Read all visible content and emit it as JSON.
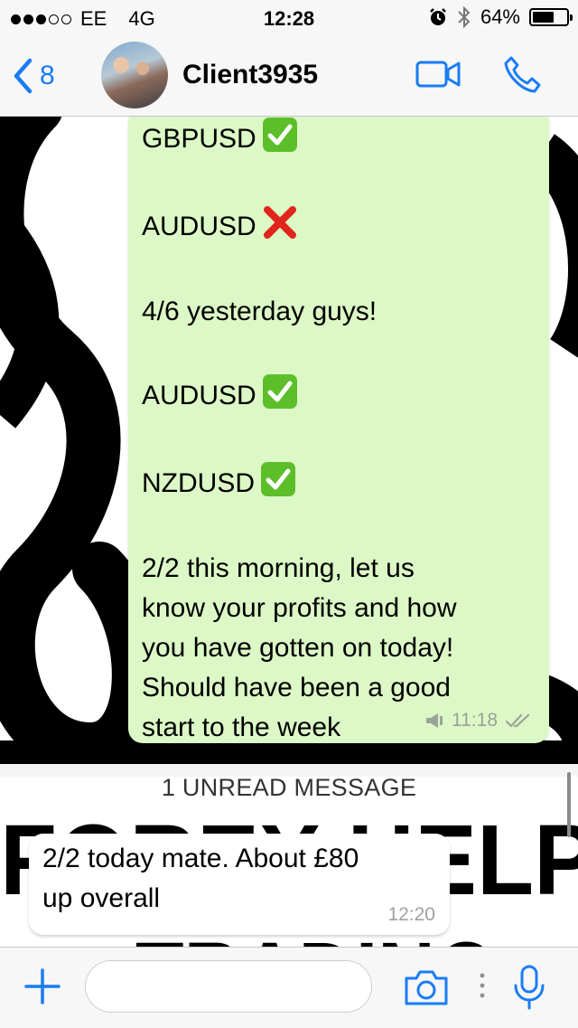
{
  "status_bar": {
    "carrier": "EE",
    "network": "4G",
    "time": "12:28",
    "battery": "64%",
    "battery_level": 0.64
  },
  "header": {
    "back_count": "8",
    "contact_name": "Client3935"
  },
  "messages": {
    "outgoing": {
      "lines": [
        "GBPUSD",
        "",
        "AUDUSD",
        "",
        "4/6 yesterday guys!",
        "",
        "AUDUSD",
        "",
        "NZDUSD",
        "",
        "2/2 this morning, let us",
        "know your profits and how",
        "you have gotten on today!",
        "Should have been a good",
        "start to the week"
      ],
      "time": "11:18"
    },
    "unread_banner": "1 UNREAD MESSAGE",
    "incoming": {
      "text_line1": "2/2 today mate. About £80",
      "text_line2": "up overall",
      "time": "12:20"
    }
  },
  "wallpaper_text": "FOREX HELP TRADING",
  "input": {
    "placeholder": ""
  },
  "colors": {
    "accent": "#1a7cf5",
    "outgoing_bubble": "#dcf8c6",
    "check_green": "#5cbf2a",
    "cross_red": "#e0261c"
  }
}
